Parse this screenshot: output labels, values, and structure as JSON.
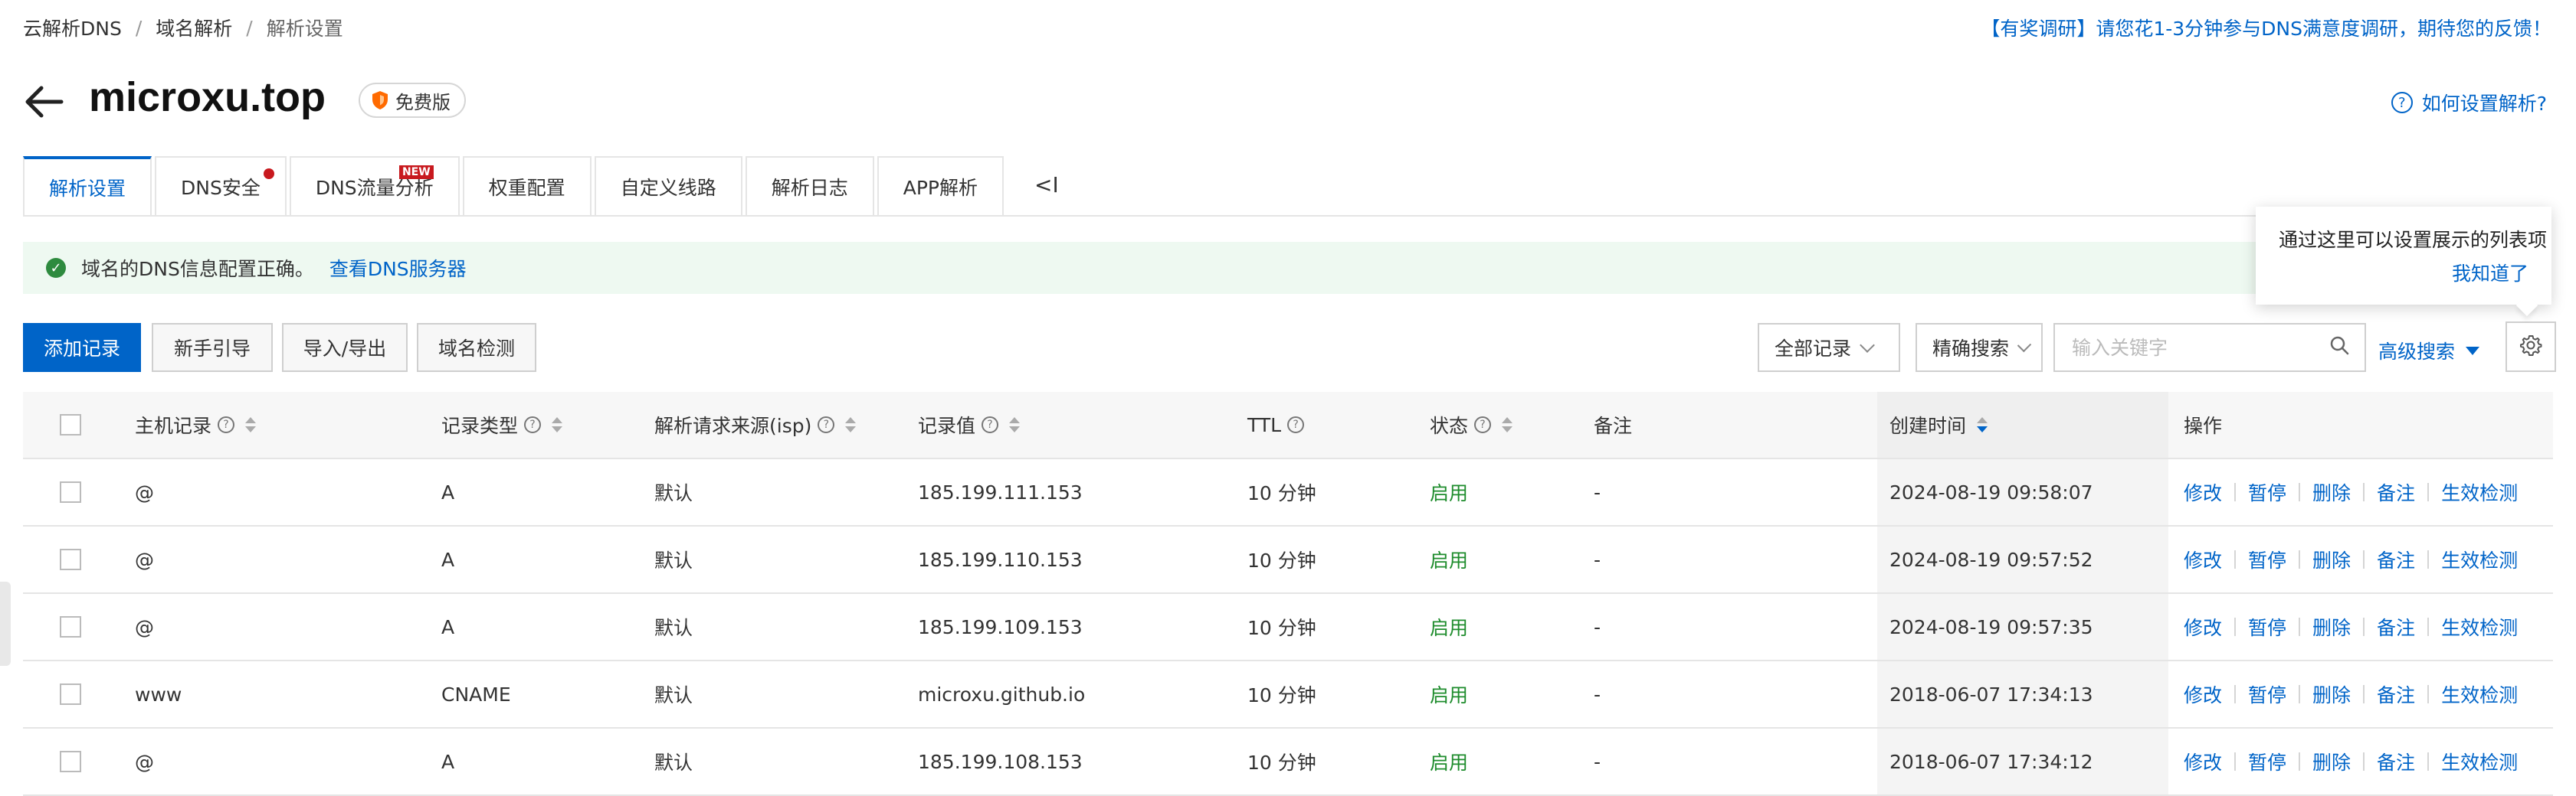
{
  "breadcrumb": [
    "云解析DNS",
    "域名解析",
    "解析设置"
  ],
  "survey_text": "【有奖调研】请您花1-3分钟参与DNS满意度调研，期待您的反馈！",
  "domain": "microxu.top",
  "edition_badge": "免费版",
  "help_link": "如何设置解析?",
  "tabs": [
    {
      "label": "解析设置",
      "active": true
    },
    {
      "label": "DNS安全",
      "dot": true
    },
    {
      "label": "DNS流量分析",
      "tag": "NEW"
    },
    {
      "label": "权重配置"
    },
    {
      "label": "自定义线路"
    },
    {
      "label": "解析日志"
    },
    {
      "label": "APP解析"
    }
  ],
  "tabs_collapse": "<I",
  "alert": {
    "text": "域名的DNS信息配置正确。",
    "link": "查看DNS服务器"
  },
  "toolbar": {
    "add": "添加记录",
    "guide": "新手引导",
    "import_export": "导入/导出",
    "check": "域名检测",
    "filter_all": "全部记录",
    "search_mode": "精确搜索",
    "search_placeholder": "输入关键字",
    "advanced": "高级搜索"
  },
  "popover": {
    "text": "通过这里可以设置展示的列表项",
    "ack": "我知道了"
  },
  "table": {
    "headers": {
      "host": "主机记录",
      "type": "记录类型",
      "isp": "解析请求来源(isp)",
      "value": "记录值",
      "ttl": "TTL",
      "status": "状态",
      "remark": "备注",
      "created": "创建时间",
      "ops": "操作"
    },
    "rows": [
      {
        "host": "@",
        "type": "A",
        "isp": "默认",
        "value": "185.199.111.153",
        "ttl": "10 分钟",
        "status": "启用",
        "remark": "-",
        "created": "2024-08-19 09:58:07"
      },
      {
        "host": "@",
        "type": "A",
        "isp": "默认",
        "value": "185.199.110.153",
        "ttl": "10 分钟",
        "status": "启用",
        "remark": "-",
        "created": "2024-08-19 09:57:52"
      },
      {
        "host": "@",
        "type": "A",
        "isp": "默认",
        "value": "185.199.109.153",
        "ttl": "10 分钟",
        "status": "启用",
        "remark": "-",
        "created": "2024-08-19 09:57:35"
      },
      {
        "host": "www",
        "type": "CNAME",
        "isp": "默认",
        "value": "microxu.github.io",
        "ttl": "10 分钟",
        "status": "启用",
        "remark": "-",
        "created": "2018-06-07 17:34:13"
      },
      {
        "host": "@",
        "type": "A",
        "isp": "默认",
        "value": "185.199.108.153",
        "ttl": "10 分钟",
        "status": "启用",
        "remark": "-",
        "created": "2018-06-07 17:34:12"
      }
    ],
    "row_actions": [
      "修改",
      "暂停",
      "删除",
      "备注",
      "生效检测"
    ]
  },
  "colors": {
    "primary": "#0064c8",
    "success": "#1e8c2c",
    "alert_bg": "#eef9f1",
    "danger": "#c8191e"
  }
}
